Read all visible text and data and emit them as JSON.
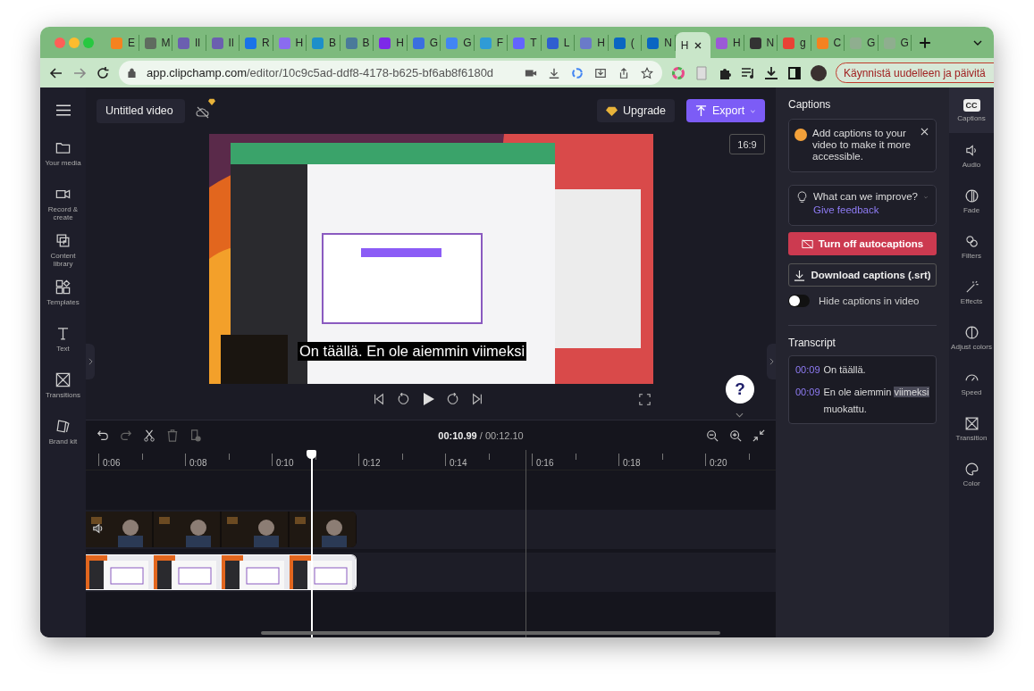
{
  "browser": {
    "tabs": [
      {
        "title": "E",
        "selected": false,
        "color": "#f58220"
      },
      {
        "title": "M",
        "selected": false,
        "color": "#5f6b5f"
      },
      {
        "title": "Il",
        "selected": false,
        "color": "#6b5fb0"
      },
      {
        "title": "Il",
        "selected": false,
        "color": "#6b5fb0"
      },
      {
        "title": "R",
        "selected": false,
        "color": "#1a73e8"
      },
      {
        "title": "H",
        "selected": false,
        "color": "#8a6cf0"
      },
      {
        "title": "B",
        "selected": false,
        "color": "#1d8fc9"
      },
      {
        "title": "B",
        "selected": false,
        "color": "#4a7a9a"
      },
      {
        "title": "H",
        "selected": false,
        "color": "#7d2ae8"
      },
      {
        "title": "G",
        "selected": false,
        "color": "#3b6fe0"
      },
      {
        "title": "G",
        "selected": false,
        "color": "#4285f4"
      },
      {
        "title": "F",
        "selected": false,
        "color": "#2f9bd6"
      },
      {
        "title": "T",
        "selected": false,
        "color": "#6364ff"
      },
      {
        "title": "L",
        "selected": false,
        "color": "#2f5fd0"
      },
      {
        "title": "H",
        "selected": false,
        "color": "#6a7ac9"
      },
      {
        "title": "(",
        "selected": false,
        "color": "#0a66c2"
      },
      {
        "title": "N",
        "selected": false,
        "color": "#0a66c2"
      },
      {
        "title": "H",
        "selected": true
      },
      {
        "title": "H",
        "selected": false,
        "color": "#9b59d6"
      },
      {
        "title": "N",
        "selected": false,
        "color": "#333333"
      },
      {
        "title": "g",
        "selected": false,
        "color": "#ea4335"
      },
      {
        "title": "C",
        "selected": false,
        "color": "#f58220"
      },
      {
        "title": "G",
        "selected": false,
        "color": "#8fae8f"
      },
      {
        "title": "G",
        "selected": false,
        "color": "#8fae8f"
      }
    ],
    "address": {
      "host": "app.clipchamp.com",
      "path": "/editor/10c9c5ad-ddf8-4178-b625-bf6ab8f6180d"
    },
    "update_button": "Käynnistä uudelleen ja päivitä"
  },
  "left_rail": {
    "items": [
      {
        "label": "Your media"
      },
      {
        "label": "Record & create"
      },
      {
        "label": "Content library"
      },
      {
        "label": "Templates"
      },
      {
        "label": "Text"
      },
      {
        "label": "Transitions"
      },
      {
        "label": "Brand kit"
      }
    ]
  },
  "header": {
    "project_title": "Untitled video",
    "upgrade": "Upgrade",
    "export": "Export"
  },
  "preview": {
    "aspect_ratio": "16:9",
    "caption": "On täällä. En ole aiemmin viimeksi"
  },
  "help": "?",
  "timeline": {
    "current_time": "00:10.99",
    "total_time": "/ 00:12.10",
    "ruler": [
      "0:06",
      "0:08",
      "0:10",
      "0:12",
      "0:14",
      "0:16",
      "0:18",
      "0:20"
    ]
  },
  "captions_panel": {
    "title": "Captions",
    "tip": "Add captions to your video to make it more accessible.",
    "feedback_question": "What can we improve?",
    "feedback_link": "Give feedback",
    "turn_off_button": "Turn off autocaptions",
    "download_button": "Download captions (.srt)",
    "hide_toggle": {
      "label": "Hide captions in video",
      "on": false
    },
    "transcript_title": "Transcript",
    "transcript": [
      {
        "time": "00:09",
        "parts": [
          {
            "text": "On täällä.",
            "highlighted": false
          }
        ]
      },
      {
        "time": "00:09",
        "parts": [
          {
            "text": "En ole aiemmin ",
            "highlighted": false
          },
          {
            "text": "viimeksi",
            "highlighted": true
          },
          {
            "text": " muokattu.",
            "highlighted": false
          }
        ]
      }
    ]
  },
  "right_rail": {
    "items": [
      {
        "label": "Captions",
        "selected": true,
        "badge": "CC"
      },
      {
        "label": "Audio",
        "selected": false
      },
      {
        "label": "Fade",
        "selected": false
      },
      {
        "label": "Filters",
        "selected": false
      },
      {
        "label": "Effects",
        "selected": false
      },
      {
        "label": "Adjust colors",
        "selected": false
      },
      {
        "label": "Speed",
        "selected": false
      },
      {
        "label": "Transition",
        "selected": false
      },
      {
        "label": "Color",
        "selected": false
      }
    ]
  }
}
